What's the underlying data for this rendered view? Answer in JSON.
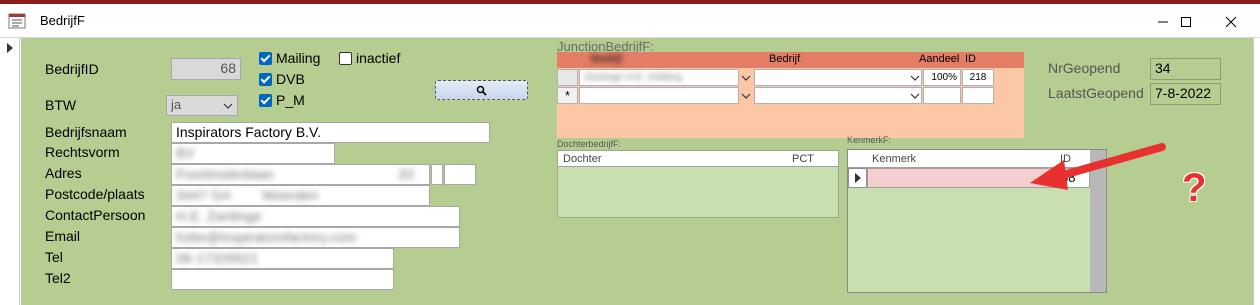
{
  "window": {
    "title": "BedrijfF",
    "form_icon": "form-icon",
    "minimize_icon": "minimize-icon",
    "maximize_icon": "maximize-icon",
    "close_icon": "close-icon"
  },
  "fields": {
    "bedrijfid": {
      "label": "BedrijfID",
      "value": "68"
    },
    "btw": {
      "label": "BTW",
      "value": "ja"
    },
    "bedrijfsnaam": {
      "label": "Bedrijfsnaam",
      "value": "Inspirators Factory B.V."
    },
    "rechtsvorm": {
      "label": "Rechtsvorm",
      "value": "BV"
    },
    "adres": {
      "label": "Adres",
      "value": "Foortmolenlaan",
      "number": "33"
    },
    "postcode": {
      "label": "Postcode/plaats",
      "value": "3447 GA",
      "plaats": "Woerden"
    },
    "contactpersoon": {
      "label": "ContactPersoon",
      "value": "H.E. Zantinge"
    },
    "email": {
      "label": "Email",
      "value": "hzbe@inspiratorsfactory.com"
    },
    "tel": {
      "label": "Tel",
      "value": "06-17326921"
    },
    "tel2": {
      "label": "Tel2",
      "value": ""
    }
  },
  "checkboxes": {
    "mailing": {
      "label": "Mailing",
      "checked": true
    },
    "inactief": {
      "label": "inactief",
      "checked": false
    },
    "dvb": {
      "label": "DVB",
      "checked": true
    },
    "p_m": {
      "label": "P_M",
      "checked": true
    }
  },
  "search_button_icon": "search-icon",
  "junction": {
    "title": "JunctionBedrijfF:",
    "headers": {
      "col1": "Bedrijf",
      "col2": "Bedrijf",
      "col3": "Aandeel",
      "col4": "ID"
    },
    "row": {
      "col1": "Zantinge H.E. Holding",
      "col2": "",
      "aandeel": "100%",
      "id": "218"
    },
    "new_record_marker": "*"
  },
  "dochter": {
    "title": "DochterbedrijfF:",
    "headers": {
      "col1": "Dochter",
      "col2": "PCT"
    }
  },
  "kenmerk": {
    "title": "KenmerkF:",
    "headers": {
      "col1": "Kenmerk",
      "col2": "ID"
    },
    "row": {
      "kenmerk": "",
      "id": "68"
    }
  },
  "stats": {
    "nrgeopend": {
      "label": "NrGeopend",
      "value": "34"
    },
    "laatstgeopend": {
      "label": "LaatstGeopend",
      "value": "7-8-2022"
    }
  },
  "annotation": {
    "question_mark": "?",
    "arrow_color": "#e8312e",
    "question_color": "#e8312e"
  },
  "colors": {
    "form_background": "#b5cd91",
    "junction_background": "#fcc7a5",
    "junction_header": "#e37d65",
    "dochter_background": "#c8e0b0",
    "kenmerk_row": "#f3cfcf"
  }
}
